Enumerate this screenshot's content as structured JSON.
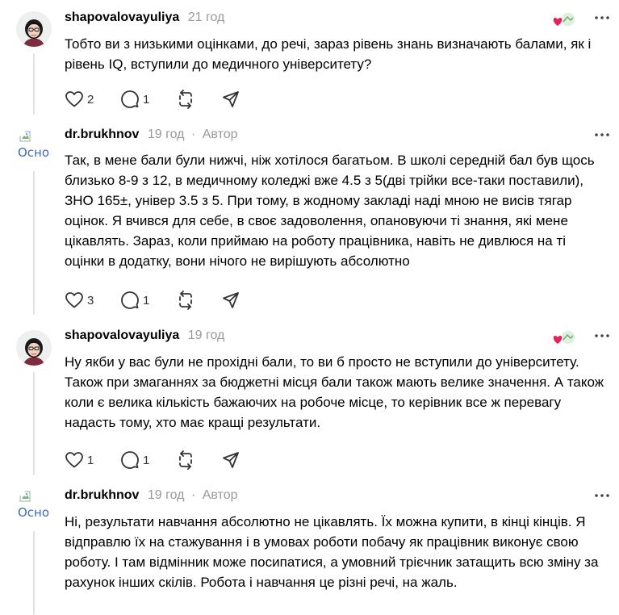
{
  "posts": [
    {
      "username": "shapovalovayuliya",
      "time": "21 год",
      "author_label": "",
      "avatar": "photo",
      "text": "Тобто ви з низькими оцінками, до речі, зараз рівень знань визначають балами, як і рівень IQ, вступили до медичного університету?",
      "likes": "2",
      "replies": "1",
      "has_likers": true
    },
    {
      "username": "dr.brukhnov",
      "time": "19 год",
      "author_label": "Автор",
      "avatar": "broken",
      "avatar_alt": "Осно",
      "text": "Так, в мене бали були нижчі, ніж хотілося багатьом. В школі середній бал був щось близько 8-9 з 12, в медичному коледжі вже 4.5 з 5(дві трійки все-таки поставили), ЗНО 165±, універ 3.5 з 5. При тому, в жодному закладі наді мною не висів тягар оцінок. Я вчився для себе, в своє задоволення, опановуючи ті знання, які мене цікавлять. Зараз, коли приймаю на роботу працівника, навіть не дивлюся на ті оцінки в додатку, вони нічого не вирішують абсолютно",
      "likes": "3",
      "replies": "1",
      "has_likers": false
    },
    {
      "username": "shapovalovayuliya",
      "time": "19 год",
      "author_label": "",
      "avatar": "photo",
      "text": "Ну якби у вас були не прохідні бали, то ви б просто не вступили до університету. Також при змаганнях за бюджетні місця бали також мають велике значення. А також коли є велика кількість бажаючих на робоче місце, то керівник все ж перевагу надасть тому, хто має кращі результати.",
      "likes": "1",
      "replies": "1",
      "has_likers": true
    },
    {
      "username": "dr.brukhnov",
      "time": "19 год",
      "author_label": "Автор",
      "avatar": "broken",
      "avatar_alt": "Осно",
      "text": "Ні, результати навчання абсолютно не цікавлять. Їх можна купити, в кінці кінців. Я відправлю їх на стажування і в умовах роботи побачу як працівник виконує свою роботу. І там відмінник може посипатися, а умовний трієчник затащить всю зміну за рахунок інших скілів. Робота і навчання це різні речі, на жаль."
    }
  ],
  "colors": {
    "meta": "#999999",
    "thread_line": "#e1e1e1",
    "heart": "#e0245e",
    "icon": "#333333"
  }
}
